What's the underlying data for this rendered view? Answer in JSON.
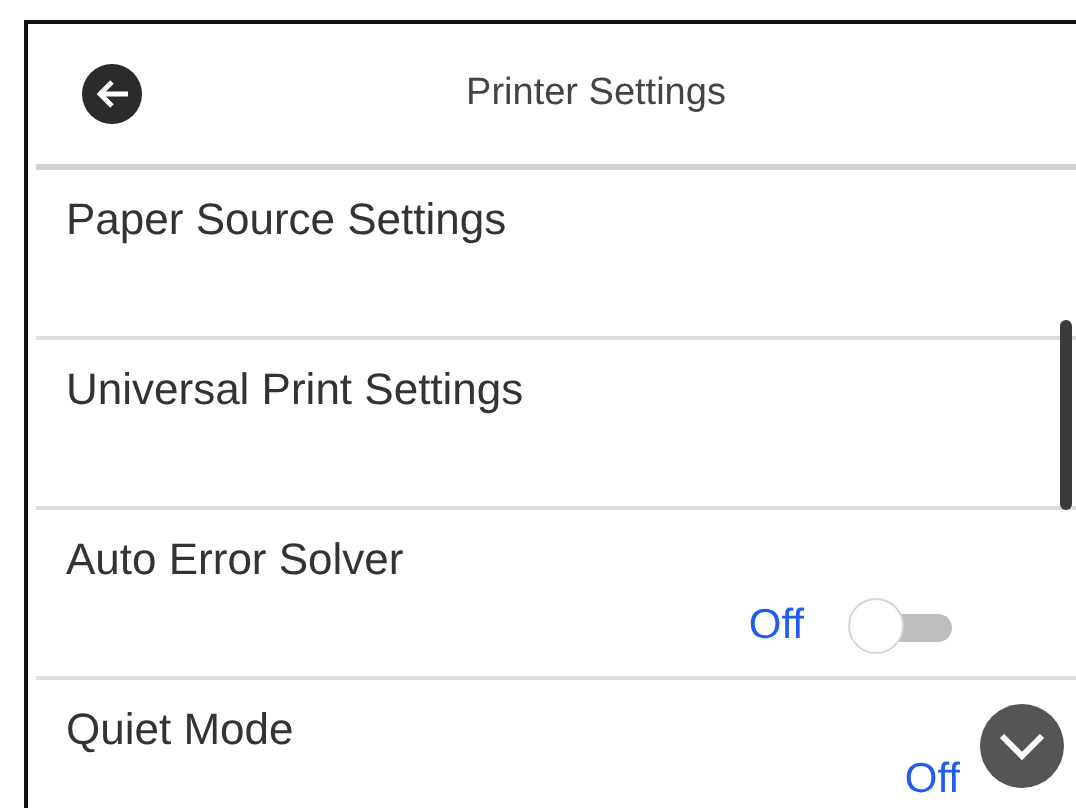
{
  "header": {
    "title": "Printer Settings"
  },
  "items": [
    {
      "kind": "link",
      "label": "Paper Source Settings"
    },
    {
      "kind": "link",
      "label": "Universal Print Settings"
    },
    {
      "kind": "toggle",
      "label": "Auto Error Solver",
      "value": "Off",
      "on": false
    },
    {
      "kind": "toggle",
      "label": "Quiet Mode",
      "value": "Off"
    }
  ]
}
